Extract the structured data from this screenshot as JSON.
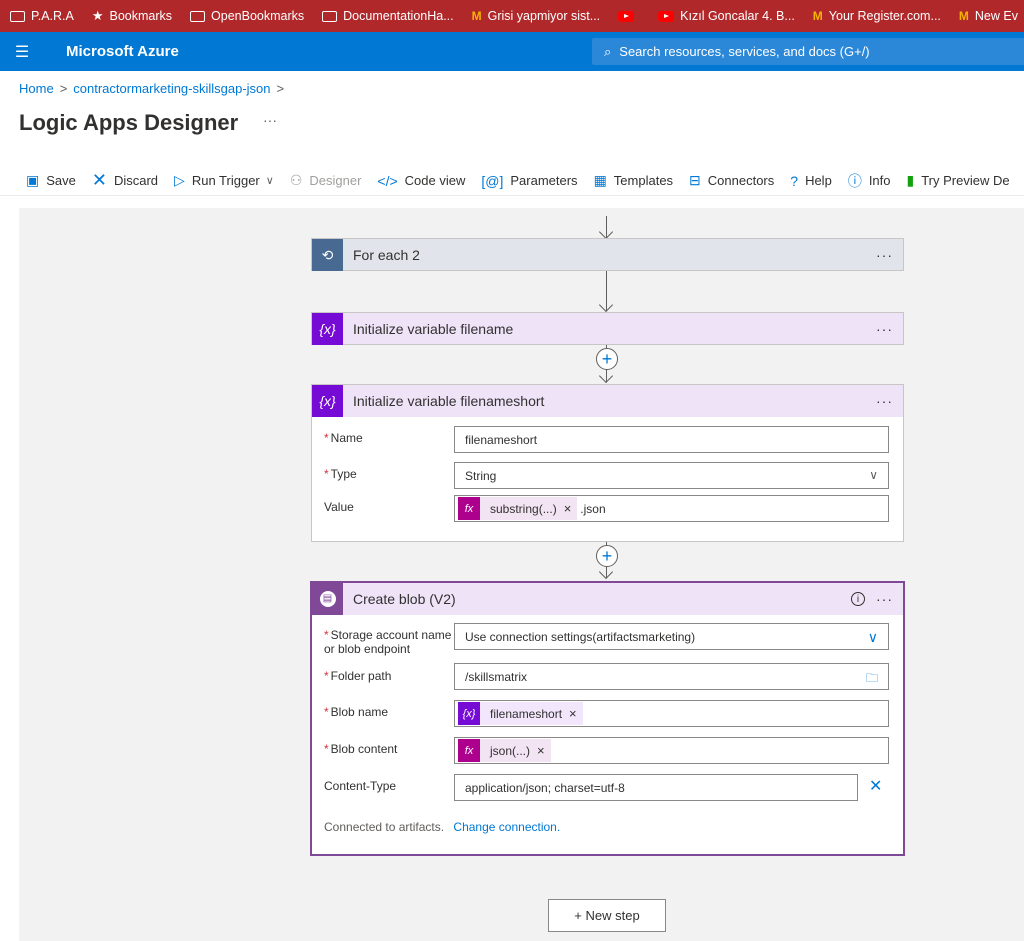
{
  "bookmarks": [
    {
      "label": "P.A.R.A",
      "icon": "folder-icon"
    },
    {
      "label": "Bookmarks",
      "icon": "star-icon"
    },
    {
      "label": "OpenBookmarks",
      "icon": "folder-icon"
    },
    {
      "label": "DocumentationHa...",
      "icon": "folder-icon"
    },
    {
      "label": "Grisi yapmiyor sist...",
      "icon": "gmail-icon"
    },
    {
      "label": "",
      "icon": "youtube-icon"
    },
    {
      "label": "Kızıl Goncalar 4. B...",
      "icon": "youtube-icon"
    },
    {
      "label": "Your Register.com...",
      "icon": "gmail-icon"
    },
    {
      "label": "New Ev",
      "icon": "gmail-icon"
    }
  ],
  "header": {
    "title": "Microsoft Azure",
    "search_placeholder": "Search resources, services, and docs (G+/)"
  },
  "breadcrumb": {
    "home": "Home",
    "resource": "contractormarketing-skillsgap-json"
  },
  "page": {
    "title": "Logic Apps Designer",
    "more": "···"
  },
  "toolbar": {
    "save": "Save",
    "discard": "Discard",
    "run_trigger": "Run Trigger",
    "designer": "Designer",
    "code_view": "Code view",
    "parameters": "Parameters",
    "templates": "Templates",
    "connectors": "Connectors",
    "help": "Help",
    "info": "Info",
    "try_preview": "Try Preview De"
  },
  "steps": {
    "foreach": {
      "title": "For each 2",
      "color": "#486991"
    },
    "init_filename": {
      "title": "Initialize variable filename",
      "color": "#770bd6"
    },
    "init_filenameshort": {
      "title": "Initialize variable filenameshort",
      "color": "#770bd6",
      "name_label": "Name",
      "name_value": "filenameshort",
      "type_label": "Type",
      "type_value": "String",
      "value_label": "Value",
      "value_token": "substring(...)",
      "value_suffix": ".json"
    },
    "create_blob": {
      "title": "Create blob (V2)",
      "color": "#804998",
      "storage_label_1": "Storage account name",
      "storage_label_2": "or blob endpoint",
      "storage_value": "Use connection settings(artifactsmarketing)",
      "folder_label": "Folder path",
      "folder_value": "/skillsmatrix",
      "blobname_label": "Blob name",
      "blobname_token": "filenameshort",
      "blobcontent_label": "Blob content",
      "blobcontent_token": "json(...)",
      "contenttype_label": "Content-Type",
      "contenttype_value": "application/json; charset=utf-8",
      "connected_text": "Connected to artifacts.",
      "change_connection": "Change connection."
    }
  },
  "new_step": "+ New step",
  "colors": {
    "accent": "#0078d4",
    "bookmark_bar": "#b0282a",
    "expression": "#ad008c",
    "variable": "#770bd6"
  }
}
